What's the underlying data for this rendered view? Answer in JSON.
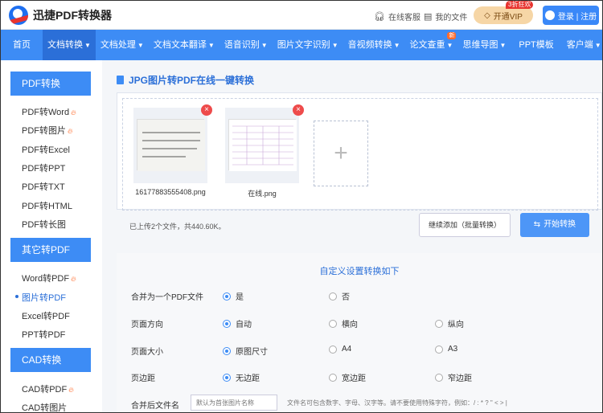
{
  "header": {
    "logo_text": "迅捷PDF转换器",
    "service_label": "在线客服",
    "docs_label": "我的文件",
    "vip_label": "开通VIP",
    "vip_badge": "3折狂欢",
    "login_label": "登录 | 注册"
  },
  "nav": {
    "items": [
      {
        "label": "首页",
        "caret": false
      },
      {
        "label": "文档转换",
        "caret": true,
        "active": true
      },
      {
        "label": "文档处理",
        "caret": true
      },
      {
        "label": "文档文本翻译",
        "caret": true
      },
      {
        "label": "语音识别",
        "caret": true
      },
      {
        "label": "图片文字识别",
        "caret": true
      },
      {
        "label": "音视频转换",
        "caret": true
      },
      {
        "label": "论文查重",
        "caret": true,
        "badge": "新"
      },
      {
        "label": "思维导图",
        "caret": true
      },
      {
        "label": "PPT模板",
        "caret": false
      },
      {
        "label": "客户端",
        "caret": true
      }
    ]
  },
  "sidebar": {
    "sections": [
      {
        "head": "PDF转换",
        "items": [
          {
            "label": "PDF转Word",
            "hot": true
          },
          {
            "label": "PDF转图片",
            "hot": true
          },
          {
            "label": "PDF转Excel"
          },
          {
            "label": "PDF转PPT"
          },
          {
            "label": "PDF转TXT"
          },
          {
            "label": "PDF转HTML"
          },
          {
            "label": "PDF转长图"
          }
        ]
      },
      {
        "head": "其它转PDF",
        "items": [
          {
            "label": "Word转PDF",
            "hot": true
          },
          {
            "label": "图片转PDF",
            "active": true
          },
          {
            "label": "Excel转PDF"
          },
          {
            "label": "PPT转PDF"
          }
        ]
      },
      {
        "head": "CAD转换",
        "items": [
          {
            "label": "CAD转PDF",
            "hot": true
          },
          {
            "label": "CAD转图片"
          }
        ]
      }
    ]
  },
  "main": {
    "title": "JPG图片转PDF在线一键转换",
    "files": [
      {
        "name": "16177883555408.png"
      },
      {
        "name": "在线.png"
      }
    ],
    "add_symbol": "+",
    "info": "已上传2个文件，共440.60K。",
    "more_button": "继续添加（批量转换）",
    "start_button": "开始转换"
  },
  "settings": {
    "title": "自定义设置转换如下",
    "rows": [
      {
        "label": "合并为一个PDF文件",
        "options": [
          "是",
          "否"
        ],
        "selected": 0
      },
      {
        "label": "页面方向",
        "options": [
          "自动",
          "横向",
          "纵向"
        ],
        "selected": 0
      },
      {
        "label": "页面大小",
        "options": [
          "原图尺寸",
          "A4",
          "A3"
        ],
        "selected": 0
      },
      {
        "label": "页边距",
        "options": [
          "无边距",
          "宽边距",
          "窄边距"
        ],
        "selected": 0
      }
    ],
    "filename_label": "合并后文件名",
    "filename_placeholder": "默认为首张图片名称",
    "filename_hint": "文件名可包含数字、字母、汉字等。请不要使用特殊字符，例如：/ : * ? \" < > |"
  },
  "colors": {
    "brand": "#3d8cf5",
    "accent": "#ff6a2b",
    "vip": "#f6d6a6"
  }
}
